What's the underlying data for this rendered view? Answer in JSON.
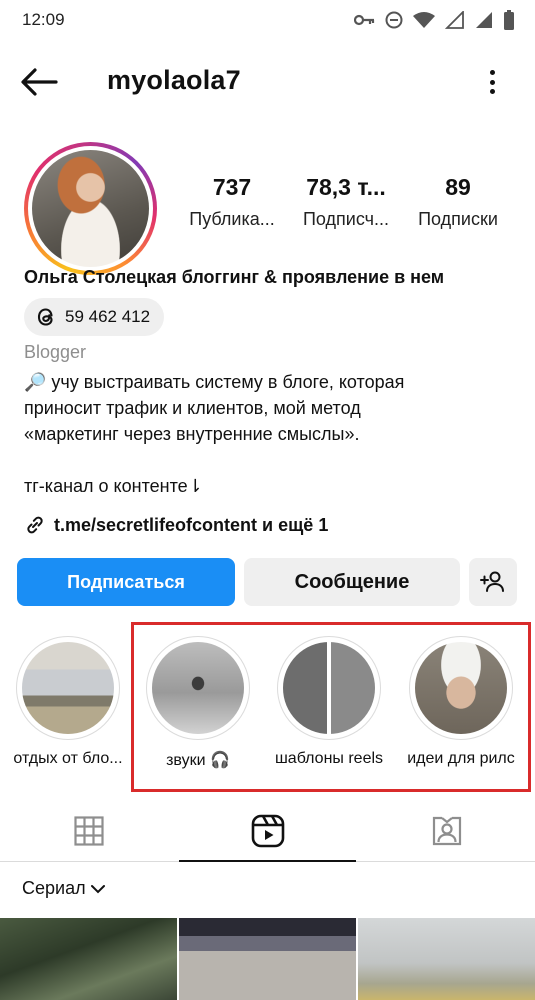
{
  "status_bar": {
    "time": "12:09"
  },
  "header": {
    "username": "myolaola7"
  },
  "stats": [
    {
      "value": "737",
      "label": "Публика..."
    },
    {
      "value": "78,3 т...",
      "label": "Подписч..."
    },
    {
      "value": "89",
      "label": "Подписки"
    }
  ],
  "profile": {
    "full_name": "Ольга Столецкая блоггинг & проявление в нем",
    "threads_count": "59 462 412",
    "category": "Blogger",
    "bio_lines": [
      "🔎 учу выстраивать систему в блоге, которая",
      "приносит трафик и клиентов, мой метод",
      "«маркетинг через внутренние смыслы».",
      "",
      "тг-канал о контенте⇂"
    ],
    "link": "t.me/secretlifeofcontent и ещё 1"
  },
  "actions": {
    "follow": "Подписаться",
    "message": "Сообщение"
  },
  "highlights": [
    {
      "label": "отдых от бло..."
    },
    {
      "label": "звуки 🎧"
    },
    {
      "label": "шаблоны reels"
    },
    {
      "label": "идеи для рилс"
    }
  ],
  "tabs": {
    "active": "reels"
  },
  "filter": {
    "label": "Сериал"
  },
  "colors": {
    "accent": "#1a8ef5",
    "highlight_frame": "#d92b2b"
  }
}
